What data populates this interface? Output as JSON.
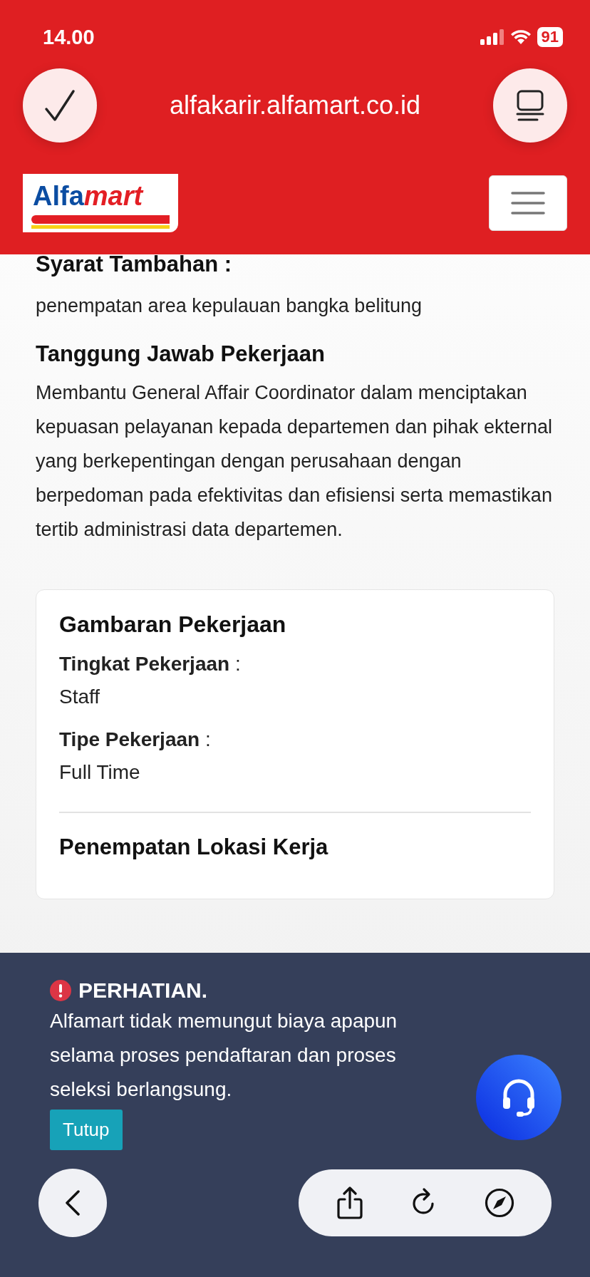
{
  "status_bar": {
    "time": "14.00",
    "battery": "91"
  },
  "browser": {
    "url": "alfakarir.alfamart.co.id"
  },
  "header": {
    "logo": [
      "Alfa",
      "mart"
    ]
  },
  "sections": [
    {
      "title": "Syarat Tambahan :",
      "body": "penempatan area kepulauan bangka belitung"
    },
    {
      "title": "Tanggung Jawab Pekerjaan",
      "body": "Membantu General Affair Coordinator dalam menciptakan kepuasan pelayanan kepada departemen dan pihak ekternal yang berkepentingan dengan perusahaan dengan berpedoman pada efektivitas dan efisiensi serta memastikan tertib administrasi data departemen."
    }
  ],
  "card": {
    "title": "Gambaran Pekerjaan",
    "fields": [
      {
        "label": "Tingkat Pekerjaan",
        "separator": ":",
        "value": "Staff"
      },
      {
        "label": "Tipe Pekerjaan",
        "separator": ":",
        "value": "Full Time"
      }
    ],
    "next_heading": "Penempatan Lokasi Kerja"
  },
  "notice": {
    "title": "PERHATIAN.",
    "body": "Alfamart tidak memungut biaya apapun selama proses pendaftaran dan proses seleksi berlangsung.",
    "button": "Tutup"
  }
}
